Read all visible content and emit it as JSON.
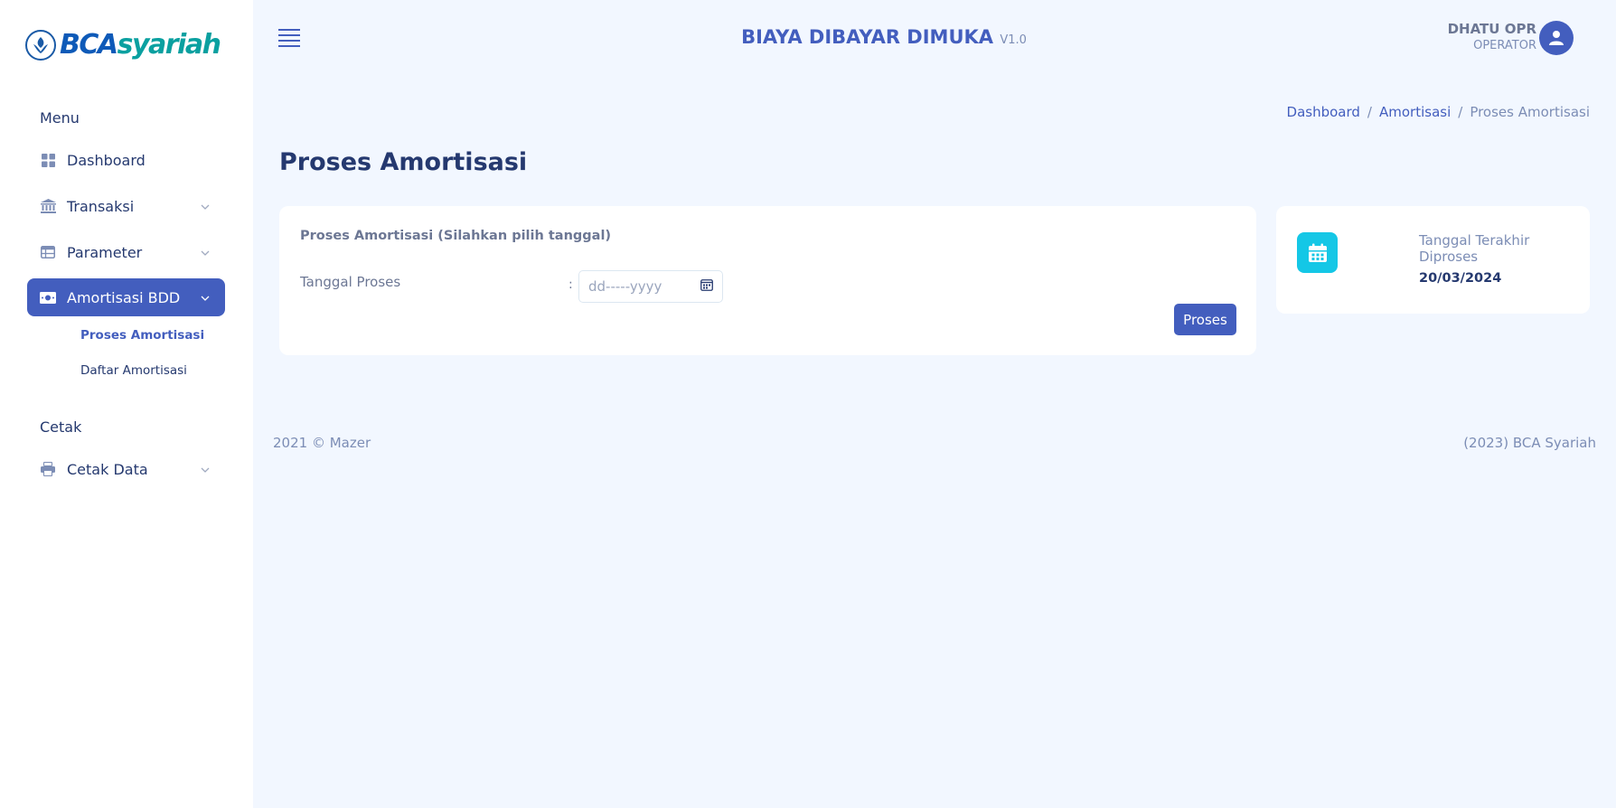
{
  "brand": {
    "part1": "BCA",
    "part2": "syariah"
  },
  "app": {
    "title": "BIAYA DIBAYAR DIMUKA",
    "version": "V1.0"
  },
  "user": {
    "name": "DHATU OPR",
    "role": "OPERATOR"
  },
  "sidebar": {
    "sections": [
      {
        "title": "Menu"
      },
      {
        "title": "Cetak"
      }
    ],
    "items": [
      {
        "label": "Dashboard",
        "icon": "grid-icon"
      },
      {
        "label": "Transaksi",
        "icon": "bank-icon"
      },
      {
        "label": "Parameter",
        "icon": "table-icon"
      },
      {
        "label": "Amortisasi BDD",
        "icon": "cash-icon",
        "active": true
      },
      {
        "label": "Cetak Data",
        "icon": "printer-icon"
      }
    ],
    "subitems": [
      {
        "label": "Proses Amortisasi",
        "active": true
      },
      {
        "label": "Daftar Amortisasi"
      }
    ]
  },
  "breadcrumb": {
    "items": [
      "Dashboard",
      "Amortisasi",
      "Proses Amortisasi"
    ]
  },
  "page": {
    "title": "Proses Amortisasi"
  },
  "form": {
    "title": "Proses Amortisasi (Silahkan pilih tanggal)",
    "label": "Tanggal Proses",
    "colon": ":",
    "placeholder": "dd-----yyyy",
    "button": "Proses"
  },
  "stat": {
    "label": "Tanggal Terakhir Diproses",
    "value": "20/03/2024"
  },
  "footer": {
    "left": "2021 © Mazer",
    "right": "(2023) BCA Syariah"
  },
  "colors": {
    "primary": "#435ebe",
    "accent": "#14c7e6",
    "background": "#f2f7ff"
  }
}
